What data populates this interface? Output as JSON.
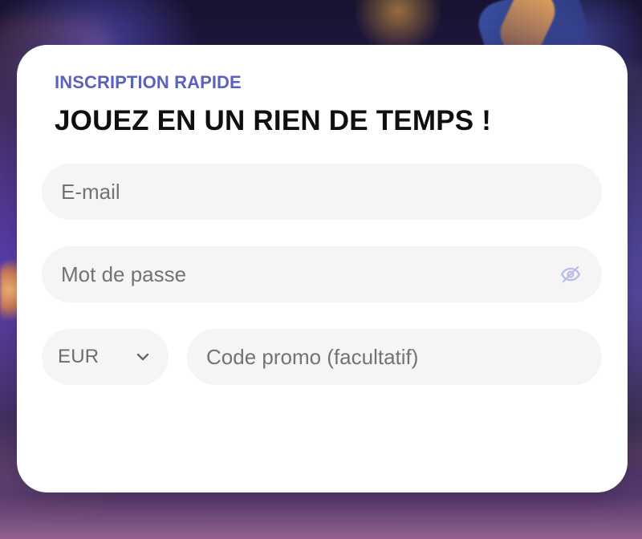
{
  "background": {
    "accent": "#6c62e6",
    "card_color": "#ffffff"
  },
  "form": {
    "eyebrow": "INSCRIPTION RAPIDE",
    "title": "JOUEZ EN UN RIEN DE TEMPS !",
    "email_placeholder": "E-mail",
    "password_placeholder": "Mot de passe",
    "currency_value": "EUR",
    "promo_placeholder": "Code promo (facultatif)"
  },
  "icons": {
    "password_toggle": "eye-off-icon",
    "currency_dropdown": "chevron-down-icon"
  },
  "colors": {
    "eyebrow": "#5963bc",
    "title": "#0f0f0f",
    "field_bg": "#f5f5f5",
    "placeholder": "#737373",
    "icon_muted": "#b7bde8"
  }
}
